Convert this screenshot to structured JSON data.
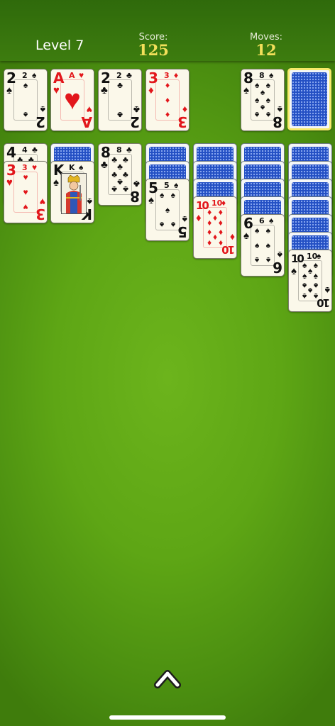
{
  "header": {
    "level_text": "Level 7",
    "score_label": "Score:",
    "score_value": "125",
    "moves_label": "Moves:",
    "moves_value": "12"
  },
  "colors": {
    "felt": "#5ea615",
    "topbar": "#356f0d",
    "stat_value": "#f3e05a",
    "red_suit": "#e2161b",
    "card_back": "#2450c4",
    "selection": "#f6ea6a"
  },
  "foundations": [
    {
      "rank": "2",
      "suit": "♠",
      "color": "black"
    },
    {
      "rank": "A",
      "suit": "♥",
      "color": "red"
    },
    {
      "rank": "2",
      "suit": "♣",
      "color": "black"
    },
    {
      "rank": "3",
      "suit": "♦",
      "color": "red"
    }
  ],
  "waste": {
    "rank": "8",
    "suit": "♠",
    "color": "black"
  },
  "stock": {
    "state": "face-down",
    "selected": true
  },
  "tableau": [
    {
      "hidden": 0,
      "cards": [
        {
          "rank": "4",
          "suit": "♣",
          "color": "black"
        },
        {
          "rank": "3",
          "suit": "♥",
          "color": "red"
        }
      ]
    },
    {
      "hidden": 1,
      "cards": [
        {
          "rank": "K",
          "suit": "♠",
          "color": "black"
        }
      ]
    },
    {
      "hidden": 0,
      "cards": [
        {
          "rank": "8",
          "suit": "♣",
          "color": "black"
        }
      ]
    },
    {
      "hidden": 2,
      "cards": [
        {
          "rank": "5",
          "suit": "♠",
          "color": "black"
        }
      ]
    },
    {
      "hidden": 3,
      "cards": [
        {
          "rank": "10",
          "suit": "♦",
          "color": "red"
        }
      ]
    },
    {
      "hidden": 4,
      "cards": [
        {
          "rank": "6",
          "suit": "♠",
          "color": "black"
        }
      ]
    },
    {
      "hidden": 6,
      "cards": [
        {
          "rank": "10",
          "suit": "♠",
          "color": "black"
        }
      ]
    }
  ],
  "footer": {
    "menu_icon": "chevron-up-icon"
  }
}
